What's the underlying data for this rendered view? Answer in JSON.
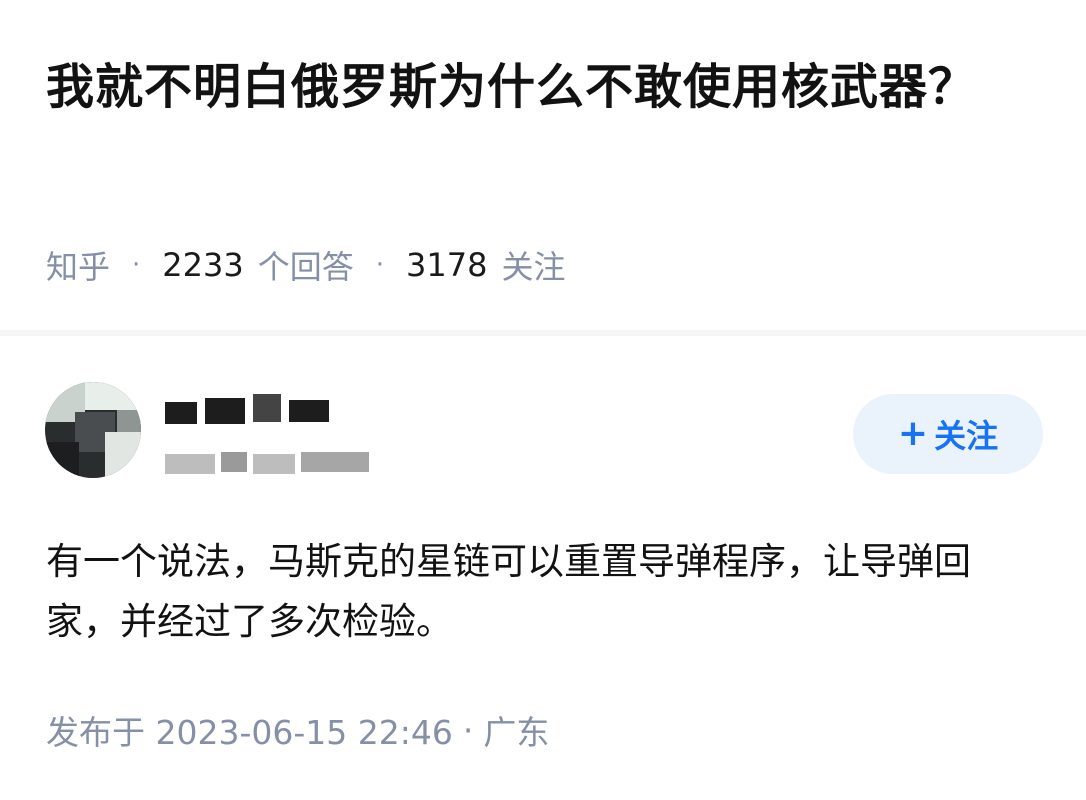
{
  "question": {
    "title": "我就不明白俄罗斯为什么不敢使用核武器？",
    "source": "知乎",
    "answers_count": "2233",
    "answers_label": "个回答",
    "followers_count": "3178",
    "followers_label": "关注"
  },
  "answer": {
    "follow_button": {
      "plus": "+",
      "label": "关注"
    },
    "content": "有一个说法，马斯克的星链可以重置导弹程序，让导弹回家，并经过了多次检验。",
    "published": "发布于 2023-06-15  22:46",
    "location": "广东"
  },
  "colors": {
    "accent": "#1772f6",
    "follow_bg": "#eaf2fc",
    "meta_text": "#8590a6",
    "title_text": "#121212",
    "divider": "#f6f6f6"
  }
}
